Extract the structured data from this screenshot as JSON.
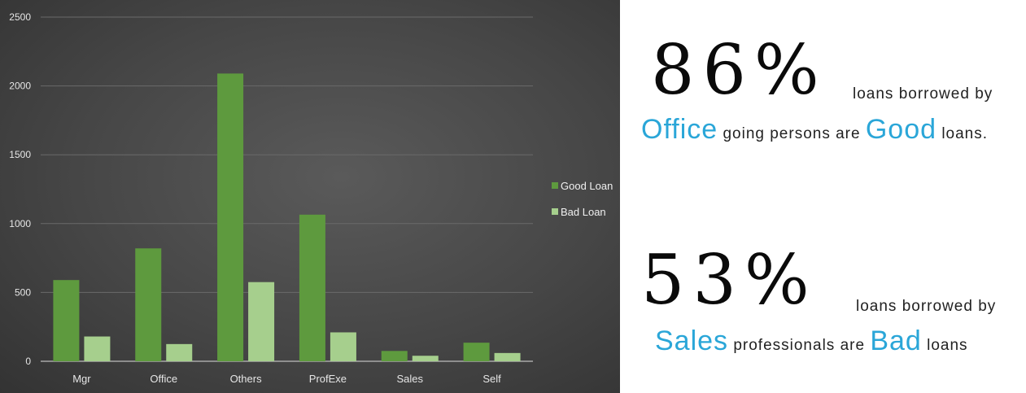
{
  "chart_data": {
    "type": "bar",
    "categories": [
      "Mgr",
      "Office",
      "Others",
      "ProfExe",
      "Sales",
      "Self"
    ],
    "series": [
      {
        "name": "Good Loan",
        "values": [
          590,
          820,
          2090,
          1065,
          75,
          135
        ],
        "color": "#5e9a3e"
      },
      {
        "name": "Bad Loan",
        "values": [
          180,
          125,
          575,
          210,
          40,
          60
        ],
        "color": "#a6cf8d"
      }
    ],
    "yticks": [
      0,
      500,
      1000,
      1500,
      2000,
      2500
    ],
    "ylim": [
      0,
      2500
    ],
    "grid": true,
    "legend": "right"
  },
  "stats": [
    {
      "percent": "86%",
      "tail": "loans borrowed by",
      "line2": [
        {
          "text": "Office",
          "highlight": true
        },
        {
          "text": " going persons are ",
          "highlight": false
        },
        {
          "text": "Good",
          "highlight": true
        },
        {
          "text": " loans.",
          "highlight": false
        }
      ]
    },
    {
      "percent": "53%",
      "tail": "loans borrowed by",
      "line2": [
        {
          "text": "Sales",
          "highlight": true
        },
        {
          "text": " professionals are ",
          "highlight": false
        },
        {
          "text": "Bad",
          "highlight": true
        },
        {
          "text": " loans",
          "highlight": false
        }
      ]
    }
  ],
  "colors": {
    "highlight": "#2aa6d8",
    "chart_background": "#464646"
  }
}
